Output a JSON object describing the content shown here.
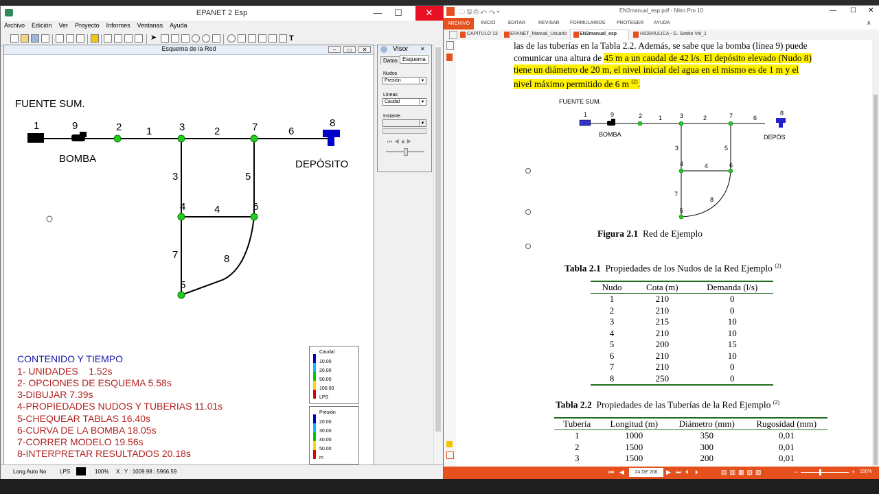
{
  "epanet": {
    "title": "EPANET 2 Esp",
    "menu": [
      "Archivo",
      "Edición",
      "Ver",
      "Proyecto",
      "Informes",
      "Ventanas",
      "Ayuda"
    ],
    "network_window_title": "Esquema de la Red",
    "network": {
      "source_label": "FUENTE SUM.",
      "pump_label": "BOMBA",
      "tank_label": "DEPÓSITO",
      "node_labels": [
        "1",
        "9",
        "2",
        "3",
        "7",
        "8",
        "4",
        "6",
        "5"
      ],
      "link_labels": [
        "1",
        "2",
        "6",
        "3",
        "5",
        "4",
        "7",
        "8"
      ]
    },
    "contents": {
      "title": "CONTENIDO Y TIEMPO",
      "items": [
        "1- UNIDADES    1.52s",
        "2- OPCIONES DE ESQUEMA 5.58s",
        "3-DIBUJAR 7.39s",
        "4-PROPIEDADES NUDOS Y TUBERIAS 11.01s",
        "5-CHEQUEAR TABLAS 16.40s",
        "6-CURVA DE LA BOMBA 18.05s",
        "7-CORRER MODELO 19.56s",
        "8-INTERPRETAR RESULTADOS 20.18s"
      ]
    },
    "legend_flow": {
      "title": "Caudal",
      "values": [
        "10.00",
        "20.00",
        "50.00",
        "100.00"
      ],
      "unit": "LPS",
      "colors": [
        "#0000cc",
        "#00bfff",
        "#00cc00",
        "#ffd700",
        "#dd0000"
      ]
    },
    "legend_pressure": {
      "title": "Presión",
      "values": [
        "20.00",
        "30.00",
        "40.00",
        "50.00"
      ],
      "unit": "m",
      "colors": [
        "#0000cc",
        "#00bfff",
        "#00cc00",
        "#ffd700",
        "#dd0000"
      ]
    },
    "visor": {
      "title": "Visor",
      "tabs": [
        "Datos",
        "Esquema"
      ],
      "nodes_label": "Nudos",
      "nodes_value": "Presión",
      "links_label": "Líneas",
      "links_value": "Caudal",
      "time_label": "Instante"
    },
    "status": {
      "autolength": "Long Auto No",
      "units": "LPS",
      "zoom": "100%",
      "coords": "X ; Y : 1009.98 ;  5966.59"
    },
    "node_color": "#22cc22"
  },
  "nitro": {
    "title": "EN2manual_esp.pdf - Nitro Pro 10",
    "ribbon": [
      "ARCHIVO",
      "INICIO",
      "EDITAR",
      "REVISAR",
      "FORMULARIOS",
      "PROTEGER",
      "AYUDA"
    ],
    "tabs": [
      "CAPITULO 13",
      "EPANET_Manual_Usuario",
      "EN2manual_esp",
      "HIDRAULICA - G. Sotelo Vol_1"
    ],
    "para": {
      "line1": "las de las tuberías en la Tabla 2.2. Además, se sabe que la bomba (línea 9) puede",
      "line2_pre": "comunicar una altura de ",
      "line2_hl": "45 m a un caudal de 42 l/s. El depósito elevado (Nudo 8)",
      "line3_hl": "tiene un diámetro de 20 m, el nivel inicial del agua en el mismo es de 1 m y el",
      "line4_hl": "nivel máximo permitido de 6 m",
      "line4_sup": "(2)",
      "line4_end": "."
    },
    "figure": {
      "source_label": "FUENTE SUM.",
      "pump_label": "BOMBA",
      "tank_label": "DEPÓSITO",
      "node_labels": [
        "1",
        "9",
        "2",
        "3",
        "7",
        "8",
        "4",
        "6",
        "5"
      ],
      "link_labels": [
        "1",
        "2",
        "6",
        "3",
        "5",
        "4",
        "7",
        "8"
      ],
      "caption_bold": "Figura 2.1",
      "caption_text": "Red de Ejemplo"
    },
    "table1": {
      "caption_bold": "Tabla 2.1",
      "caption_text": "Propiedades de los Nudos de la Red Ejemplo",
      "caption_sup": "(2)",
      "headers": [
        "Nudo",
        "Cota (m)",
        "Demanda (l/s)"
      ],
      "rows": [
        [
          "1",
          "210",
          "0"
        ],
        [
          "2",
          "210",
          "0"
        ],
        [
          "3",
          "215",
          "10"
        ],
        [
          "4",
          "210",
          "10"
        ],
        [
          "5",
          "200",
          "15"
        ],
        [
          "6",
          "210",
          "10"
        ],
        [
          "7",
          "210",
          "0"
        ],
        [
          "8",
          "250",
          "0"
        ]
      ]
    },
    "table2": {
      "caption_bold": "Tabla 2.2",
      "caption_text": "Propiedades de las Tuberías de la Red Ejemplo",
      "caption_sup": "(2)",
      "headers": [
        "Tubería",
        "Longitud (m)",
        "Diámetro (mm)",
        "Rugosidad (mm)"
      ],
      "rows": [
        [
          "1",
          "1000",
          "350",
          "0,01"
        ],
        [
          "2",
          "1500",
          "300",
          "0,01"
        ],
        [
          "3",
          "1500",
          "200",
          "0,01"
        ]
      ]
    },
    "bottom": {
      "page": "24 DE 206",
      "zoom": "150%"
    },
    "accent": "#e5501d"
  }
}
